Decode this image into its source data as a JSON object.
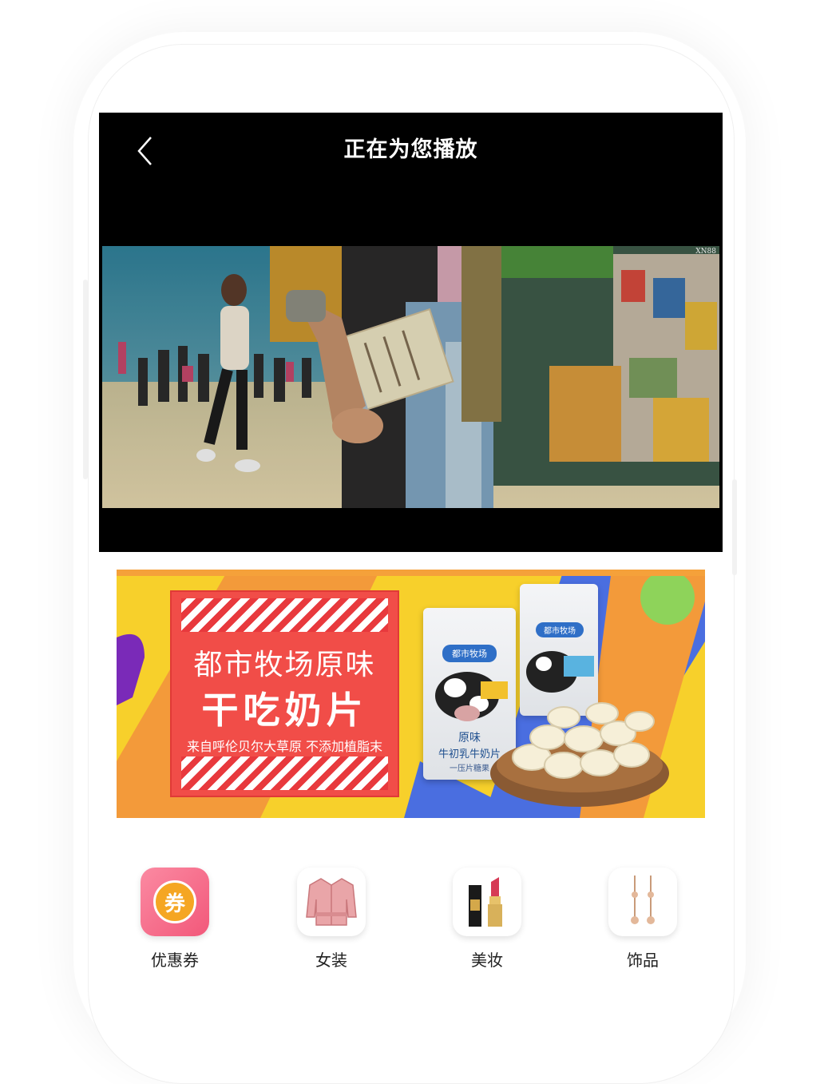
{
  "player": {
    "title": "正在为您播放",
    "watermark": "XN88"
  },
  "banner": {
    "headline": "都市牧场原味",
    "product": "干吃奶片",
    "tagline": "来自呼伦贝尔大草原 不添加植脂末",
    "pack_brand": "都市牧场",
    "pack_name": "原味",
    "pack_sub": "牛初乳牛奶片",
    "pack_desc": "一压片糖果"
  },
  "categories": [
    {
      "label": "优惠券",
      "icon": "coupon-icon",
      "glyph": "券"
    },
    {
      "label": "女装",
      "icon": "jacket-icon"
    },
    {
      "label": "美妆",
      "icon": "lipstick-icon"
    },
    {
      "label": "饰品",
      "icon": "earring-icon"
    }
  ],
  "colors": {
    "player_bg": "#000000",
    "banner_yellow": "#f7d02b",
    "promo_red": "#f14d48",
    "coupon_pink": "#f6758f"
  }
}
